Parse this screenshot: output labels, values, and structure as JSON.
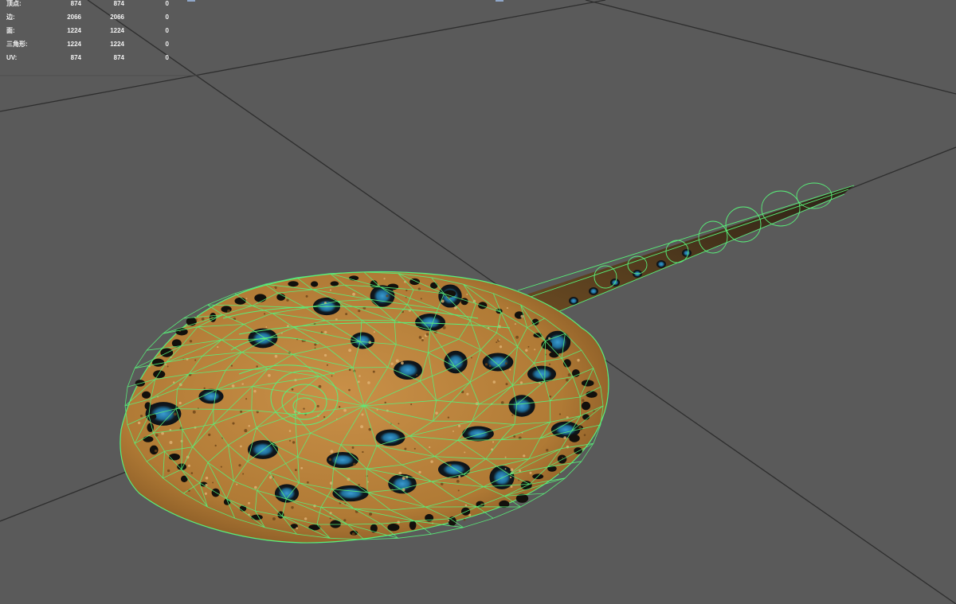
{
  "viewport": {
    "background": "#5a5a5a",
    "grid_color": "#2e2e2e",
    "wireframe_color": "#59f07a",
    "texture_colors": {
      "body": "#b07a35",
      "spot": "#10181e",
      "spot_center": "#2f8cc0"
    }
  },
  "stats": [
    {
      "label": "顶点:",
      "a": "874",
      "b": "874",
      "c": "0"
    },
    {
      "label": "边:",
      "a": "2066",
      "b": "2066",
      "c": "0"
    },
    {
      "label": "面:",
      "a": "1224",
      "b": "1224",
      "c": "0"
    },
    {
      "label": "三角形:",
      "a": "1224",
      "b": "1224",
      "c": "0"
    },
    {
      "label": "UV:",
      "a": "874",
      "b": "874",
      "c": "0"
    }
  ]
}
